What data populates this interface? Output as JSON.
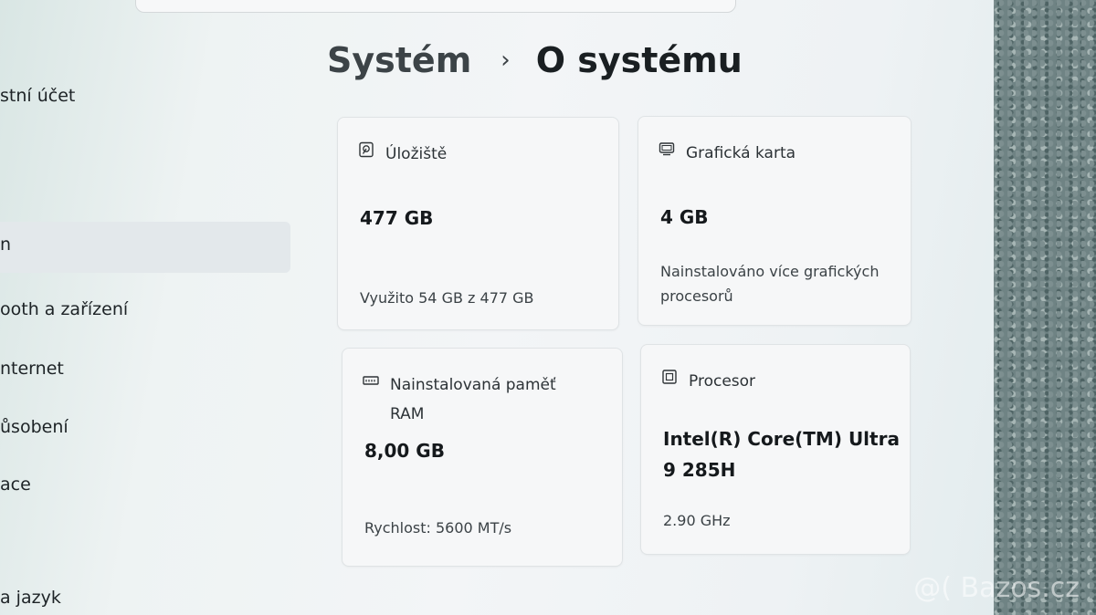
{
  "breadcrumb": {
    "parent": "Systém",
    "separator": "›",
    "current": "O systému"
  },
  "sidebar": {
    "items": [
      {
        "label": "stní účet"
      },
      {
        "label": "n"
      },
      {
        "label": "ooth a zařízení"
      },
      {
        "label": "nternet"
      },
      {
        "label": "ůsobení"
      },
      {
        "label": "ace"
      },
      {
        "label": "a jazyk"
      }
    ]
  },
  "cards": {
    "storage": {
      "label": "Úložiště",
      "value": "477 GB",
      "sub": "Využito 54 GB z 477 GB",
      "icon": "hard-drive-icon"
    },
    "gpu": {
      "label": "Grafická karta",
      "value": "4 GB",
      "sub": "Nainstalováno více grafických procesorů",
      "icon": "monitor-icon"
    },
    "ram": {
      "label": "Nainstalovaná paměť RAM",
      "value": "8,00 GB",
      "sub": "Rychlost: 5600 MT/s",
      "icon": "memory-icon"
    },
    "cpu": {
      "label": "Procesor",
      "value": "Intel(R) Core(TM) Ultra 9 285H",
      "sub": "2.90 GHz",
      "icon": "cpu-icon"
    }
  },
  "watermark": "@( Bazos.cz"
}
